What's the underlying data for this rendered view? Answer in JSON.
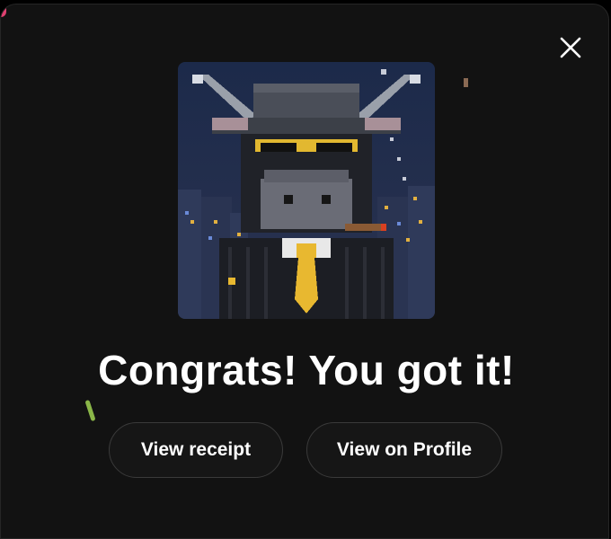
{
  "dialog": {
    "close_icon": "close-icon",
    "image_alt_icon": "pixel-art-goat-nft",
    "headline": "Congrats! You got it!",
    "buttons": {
      "receipt_label": "View receipt",
      "profile_label": "View on Profile"
    }
  },
  "colors": {
    "background": "#121212",
    "button_border": "#3a3a3a",
    "text": "#ffffff",
    "tie_gold": "#e8b830"
  }
}
